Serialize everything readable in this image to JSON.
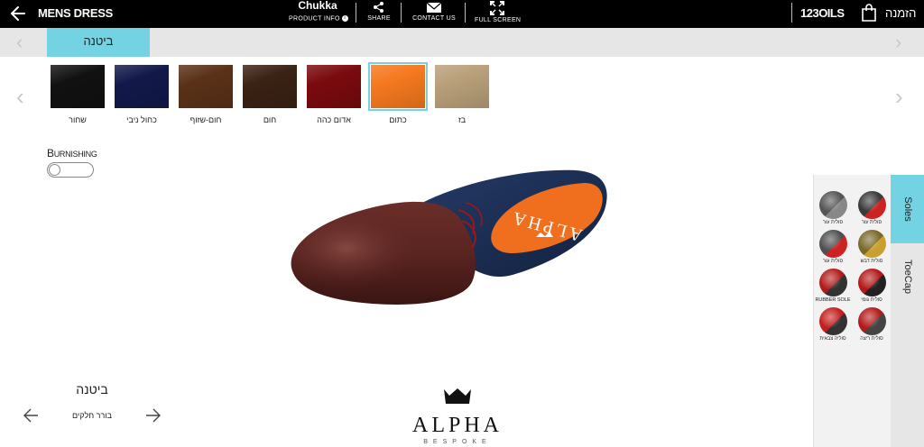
{
  "header": {
    "brand": "MENS DRESS",
    "model": "Chukka",
    "product_info": "PRODUCT INFO",
    "actions": {
      "share": "SHARE",
      "contact": "CONTACT US",
      "fullscreen": "FULL SCREEN"
    },
    "account": "123OILS",
    "order": "הזמנה"
  },
  "category": {
    "active_tab": "ביטנה"
  },
  "swatches": [
    {
      "label": "שחור",
      "color": "#111111"
    },
    {
      "label": "כחול ניבי",
      "color": "#12194a"
    },
    {
      "label": "חום-שזוף",
      "color": "#5a3118"
    },
    {
      "label": "חום",
      "color": "#3a2214"
    },
    {
      "label": "אדום כהה",
      "color": "#7a0a0e"
    },
    {
      "label": "כתום",
      "color": "#f5791f"
    },
    {
      "label": "בז",
      "color": "#b9a07a"
    }
  ],
  "selected_swatch": "כתום",
  "burnishing": {
    "label_first": "B",
    "label_rest": "URNISHING",
    "enabled": false
  },
  "part_nav": {
    "title": "ביטנה",
    "subtitle": "בורר חלקים"
  },
  "logo": {
    "name": "ALPHA",
    "tag": "BESPOKE"
  },
  "shoe": {
    "insole_text": "ALPHA"
  },
  "side_tabs": [
    {
      "label": "Soles",
      "active": true
    },
    {
      "label": "ToeCap",
      "active": false
    }
  ],
  "soles": [
    {
      "label": "סולית עור",
      "color": "#3a3a3a",
      "accent": "#c22"
    },
    {
      "label": "סולית עור",
      "color": "#555555",
      "accent": "#888"
    },
    {
      "label": "סולית דבש",
      "color": "#7a6a2a",
      "accent": "#c9a030"
    },
    {
      "label": "סולית עור",
      "color": "#505050",
      "accent": "#c22"
    },
    {
      "label": "סולית גומי",
      "color": "#b31b1b",
      "accent": "#222"
    },
    {
      "label": "RUBBER SOLE",
      "color": "#b31b1b",
      "accent": "#333"
    },
    {
      "label": "סולית ריצה",
      "color": "#b31b1b",
      "accent": "#444"
    },
    {
      "label": "סוליה צבאית",
      "color": "#c41f1f",
      "accent": "#333"
    }
  ],
  "colors": {
    "accent": "#74d3e3",
    "topbar": "#000000"
  }
}
